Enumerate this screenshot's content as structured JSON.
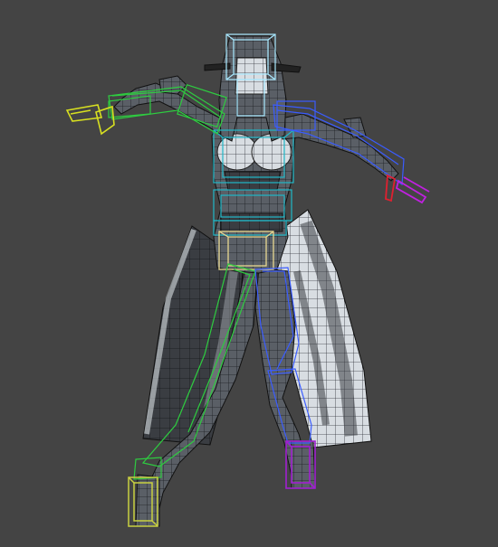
{
  "viewport": {
    "background": "#444444",
    "shading": "smooth-with-wireframe",
    "description_icon": "3d-viewport-icon"
  },
  "model": {
    "mesh_color": "#5a5f66",
    "wire_color": "#1a1c20",
    "highlight_color": "#e8eef2"
  },
  "rig": {
    "head": "#a8e8ff",
    "spine": "#20b8c8",
    "pelvis": "#e8d890",
    "left_arm": "#2ecc40",
    "left_hand": "#d8e020",
    "right_arm": "#3a5cff",
    "right_hand_finger_a": "#e02030",
    "right_hand_finger_b": "#c020e0",
    "left_leg": "#2ecc40",
    "left_foot": "#c8d040",
    "right_leg": "#3a5cff",
    "right_foot": "#a020d0"
  }
}
